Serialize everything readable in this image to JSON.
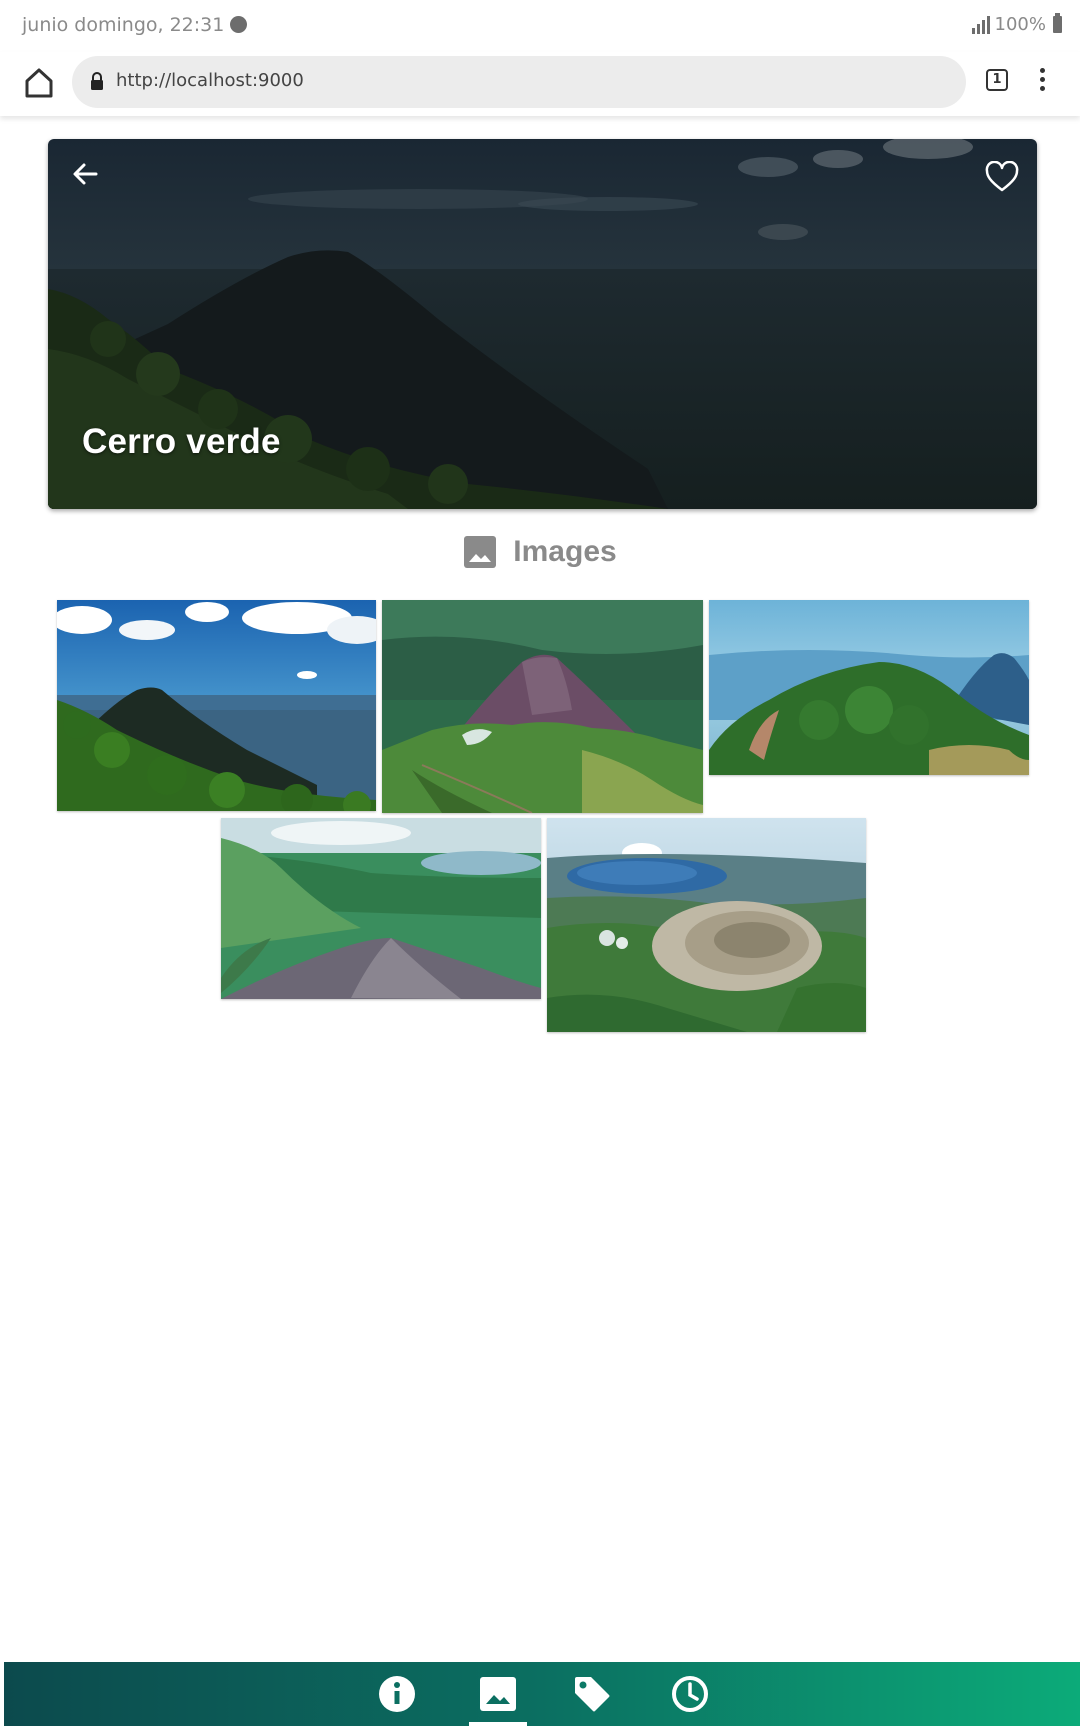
{
  "status_bar": {
    "time_text": "junio domingo, 22:31",
    "battery_text": "100%"
  },
  "browser": {
    "url": "http://localhost:9000",
    "tab_count": "1"
  },
  "hero": {
    "title": "Cerro verde",
    "favorited": false
  },
  "gallery": {
    "title": "Images",
    "images": [
      {
        "name": "gallery-image-1"
      },
      {
        "name": "gallery-image-2"
      },
      {
        "name": "gallery-image-3"
      },
      {
        "name": "gallery-image-4"
      },
      {
        "name": "gallery-image-5"
      }
    ]
  },
  "bottom_nav": {
    "items": [
      {
        "icon": "info-icon",
        "active": false
      },
      {
        "icon": "image-icon",
        "active": true
      },
      {
        "icon": "tag-icon",
        "active": false
      },
      {
        "icon": "clock-icon",
        "active": false
      }
    ],
    "gradient_start": "#0c4a4d",
    "gradient_end": "#0cab79"
  }
}
